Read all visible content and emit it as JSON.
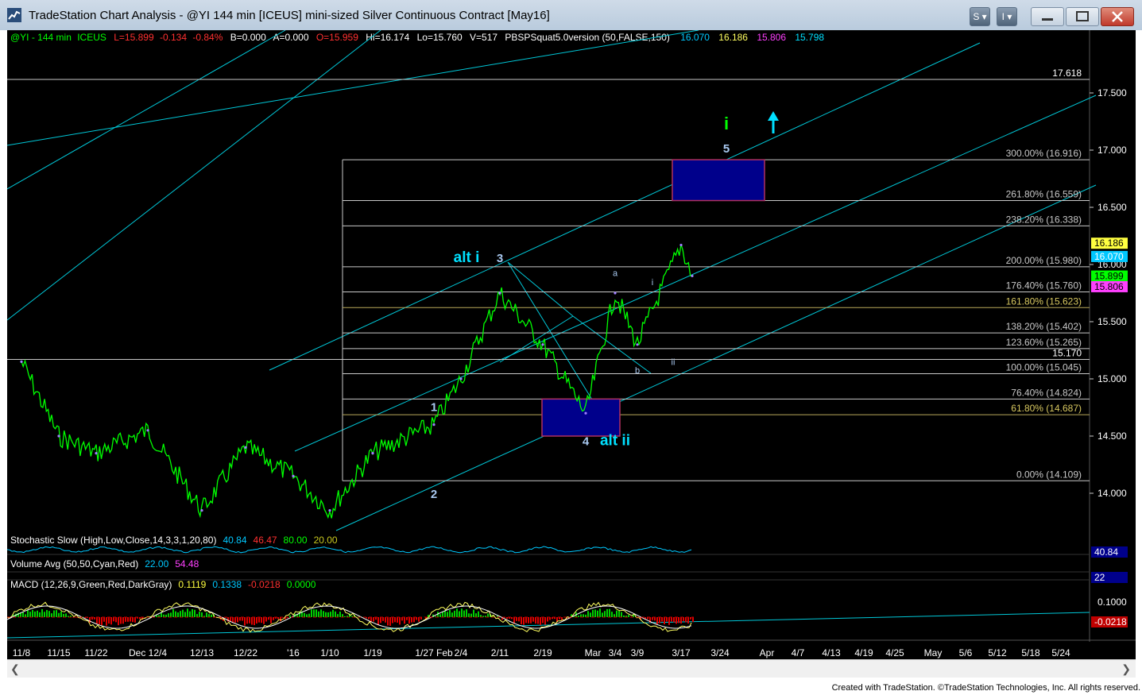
{
  "window": {
    "title": "TradeStation Chart Analysis - @YI 144 min [ICEUS] mini-sized Silver Continuous Contract [May16]",
    "buttons": [
      "S",
      "I"
    ],
    "footer": "Created with TradeStation. ©TradeStation Technologies, Inc. All rights reserved."
  },
  "colors": {
    "bg": "#000000",
    "price": "#00ff00",
    "channel": "#00c8d8",
    "fib": "#c8c8c8",
    "fib_gold": "#b8a85a",
    "box_fill": "#00008b",
    "box_edge": "#b03060",
    "wave_label": "#a8c8f0",
    "wave_green": "#00ff00",
    "cyan_label": "#00e0ff"
  },
  "header": {
    "symbol": "@YI - 144 min",
    "exchange": "ICEUS",
    "last": "L=15.899",
    "change": "-0.134",
    "change_pct": "-0.84%",
    "bid": "B=0.000",
    "ask": "A=0.000",
    "open": "O=15.959",
    "high": "Hi=16.174",
    "low": "Lo=15.760",
    "volume": "V=517",
    "study": "PBSPSquat5.0version (50,FALSE,150)",
    "study_values": [
      "16.070",
      "16.186",
      "15.806",
      "15.798"
    ]
  },
  "chart_data": {
    "type": "line",
    "title": "",
    "x_ticks": [
      "11/8",
      "11/15",
      "11/22",
      "Dec 12/4",
      "12/13",
      "12/22",
      "'16",
      "1/10",
      "1/19",
      "1/27 Feb",
      "2/4",
      "2/11",
      "2/19",
      "Mar",
      "3/4",
      "3/9",
      "3/17",
      "3/24",
      "Apr",
      "4/7",
      "4/13",
      "4/19",
      "4/25",
      "May",
      "5/6",
      "5/12",
      "5/18",
      "5/24"
    ],
    "y_ticks": [
      14.0,
      14.5,
      15.0,
      15.5,
      16.0,
      16.5,
      17.0,
      17.5
    ],
    "ylim": [
      13.7,
      17.95
    ],
    "series": [
      {
        "name": "@YI",
        "x": [
          "11/8",
          "11/15",
          "11/22",
          "12/4",
          "12/13",
          "12/22",
          "1/4",
          "1/10",
          "1/19",
          "1/27",
          "2/4",
          "2/11",
          "2/19",
          "3/1",
          "3/4",
          "3/9",
          "3/17",
          "3/18"
        ],
        "values": [
          15.15,
          14.5,
          14.35,
          14.55,
          13.85,
          14.4,
          14.15,
          13.85,
          14.35,
          14.6,
          15.0,
          15.75,
          15.3,
          14.7,
          15.75,
          15.3,
          16.17,
          15.9
        ]
      }
    ],
    "fib_levels": [
      {
        "label": "300.00% (16.916)",
        "value": 16.916
      },
      {
        "label": "261.80% (16.559)",
        "value": 16.559
      },
      {
        "label": "238.20% (16.338)",
        "value": 16.338
      },
      {
        "label": "200.00% (15.980)",
        "value": 15.98
      },
      {
        "label": "176.40% (15.760)",
        "value": 15.76
      },
      {
        "label": "161.80% (15.623)",
        "value": 15.623
      },
      {
        "label": "138.20% (15.402)",
        "value": 15.402
      },
      {
        "label": "123.60% (15.265)",
        "value": 15.265
      },
      {
        "label": "100.00% (15.045)",
        "value": 15.045
      },
      {
        "label": "76.40% (14.824)",
        "value": 14.824
      },
      {
        "label": "61.80% (14.687)",
        "value": 14.687
      },
      {
        "label": "0.00% (14.109)",
        "value": 14.109
      }
    ],
    "horizontal_lines": [
      {
        "label": "17.618",
        "value": 17.618
      },
      {
        "label": "15.170",
        "value": 15.17
      }
    ],
    "wave_labels": [
      {
        "text": "1",
        "x": "1/27",
        "value": 14.72
      },
      {
        "text": "2",
        "x": "1/27",
        "value": 13.96
      },
      {
        "text": "3",
        "x": "2/11",
        "value": 16.02
      },
      {
        "text": "4",
        "x": "3/1",
        "value": 14.42
      },
      {
        "text": "5",
        "x": "3/22",
        "value": 16.98
      },
      {
        "text": "i",
        "x": "3/22",
        "value": 17.18
      },
      {
        "text": "alt i",
        "x": "2/6",
        "value": 16.02
      },
      {
        "text": "alt ii",
        "x": "3/4",
        "value": 14.42
      },
      {
        "text": "a",
        "x": "3/4",
        "value": 15.9
      },
      {
        "text": "b",
        "x": "3/9",
        "value": 15.05
      },
      {
        "text": "i",
        "x": "3/11",
        "value": 15.82
      },
      {
        "text": "ii",
        "x": "3/14",
        "value": 15.12
      }
    ],
    "price_markers": [
      "16.186",
      "16.070",
      "15.899",
      "15.806"
    ],
    "indicators": [
      {
        "label": "Stochastic Slow (High,Low,Close,14,3,3,1,20,80)",
        "values": [
          "40.84",
          "46.47",
          "80.00",
          "20.00"
        ],
        "marker": "40.84"
      },
      {
        "label": "Volume Avg (50,50,Cyan,Red)",
        "values": [
          "22.00",
          "54.48"
        ],
        "marker": "22"
      },
      {
        "label": "MACD (12,26,9,Green,Red,DarkGray)",
        "values": [
          "0.1119",
          "0.1338",
          "-0.0218",
          "0.0000"
        ],
        "marker": "-0.0218",
        "axis_tick": "0.1000"
      }
    ]
  }
}
